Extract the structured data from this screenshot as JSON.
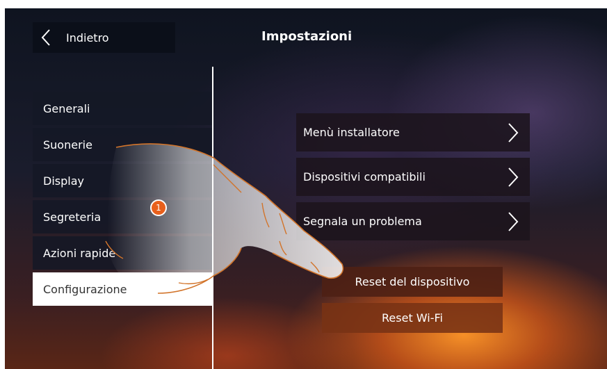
{
  "header": {
    "back_label": "Indietro",
    "title": "Impostazioni"
  },
  "menu": {
    "items": [
      {
        "label": "Generali"
      },
      {
        "label": "Suonerie"
      },
      {
        "label": "Display"
      },
      {
        "label": "Segreteria"
      },
      {
        "label": "Azioni rapide"
      },
      {
        "label": "Configurazione",
        "active": true
      }
    ]
  },
  "config": {
    "items": [
      {
        "label": "Menù installatore"
      },
      {
        "label": "Dispositivi compatibili"
      },
      {
        "label": "Segnala un problema"
      }
    ],
    "reset_device_label": "Reset del dispositivo",
    "reset_wifi_label": "Reset Wi-Fi"
  },
  "overlay": {
    "step_number": "1",
    "hand_icon": "pointing-hand-icon"
  },
  "colors": {
    "badge": "#e8601c",
    "panel": "#141826",
    "active_item_bg": "#ffffff"
  }
}
